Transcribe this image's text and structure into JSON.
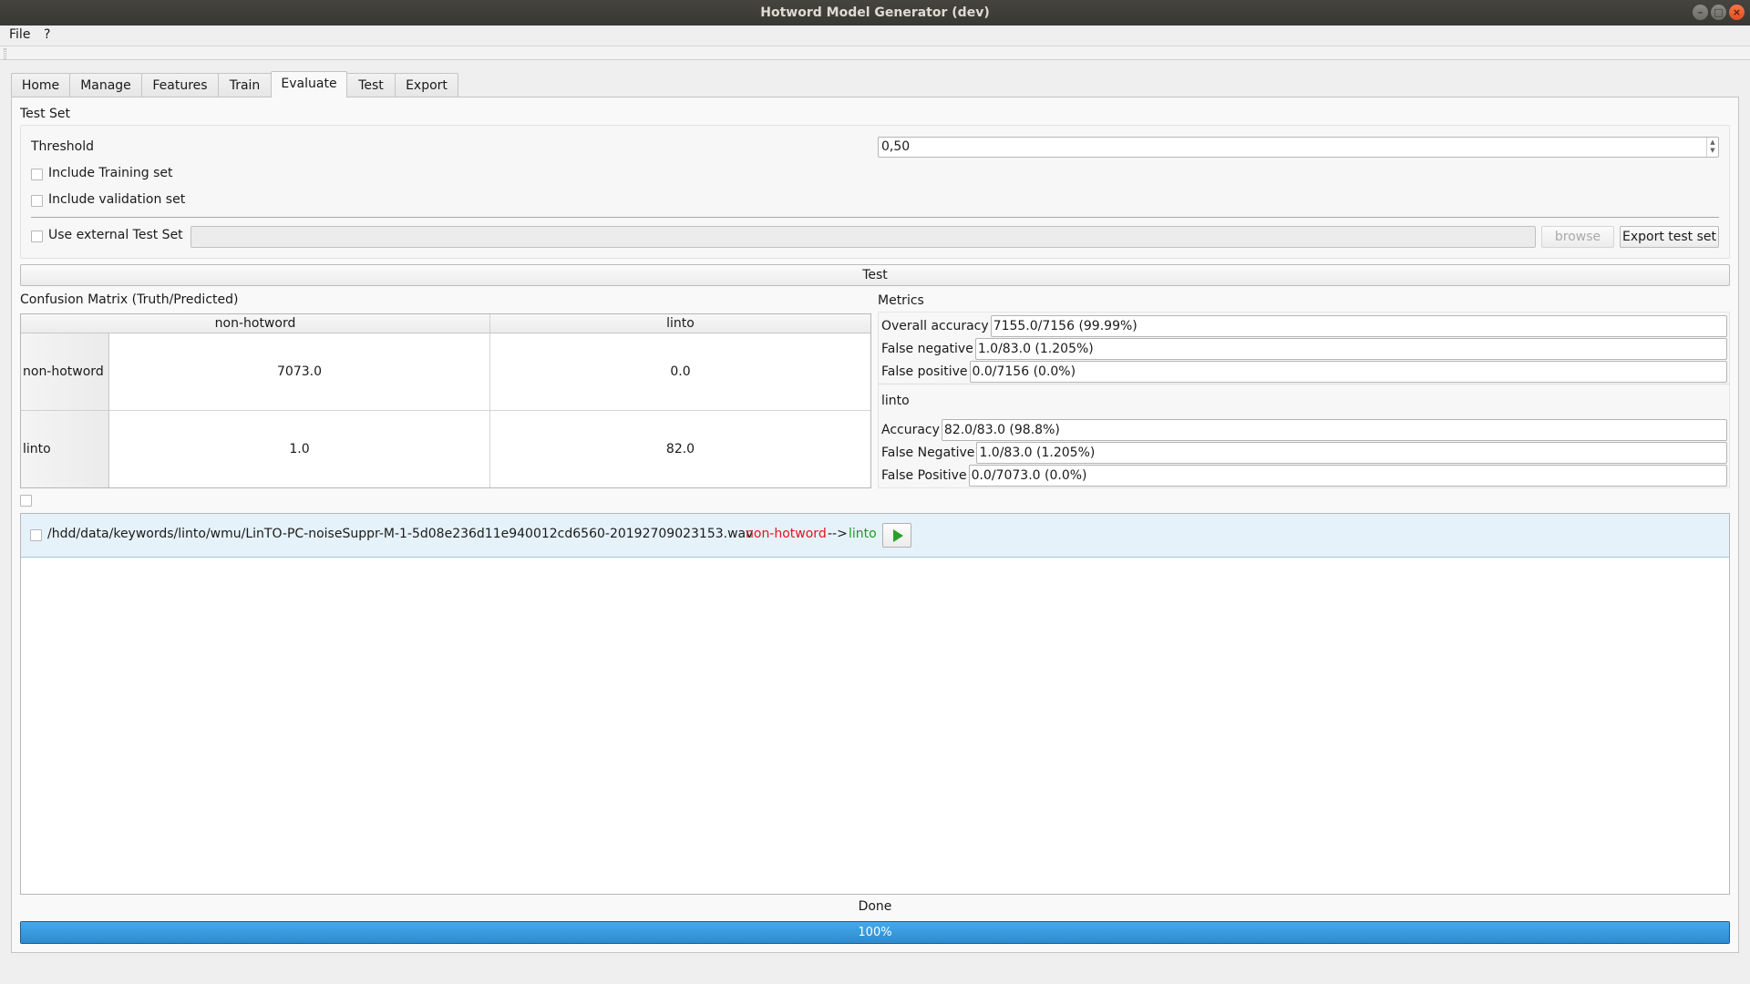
{
  "window": {
    "title": "Hotword Model Generator (dev)",
    "controls": {
      "minimize": "–",
      "maximize": "□",
      "close": "×"
    }
  },
  "menu": {
    "items": [
      "File",
      "?"
    ]
  },
  "tabs": [
    {
      "label": "Home",
      "active": false
    },
    {
      "label": "Manage",
      "active": false
    },
    {
      "label": "Features",
      "active": false
    },
    {
      "label": "Train",
      "active": false
    },
    {
      "label": "Evaluate",
      "active": true
    },
    {
      "label": "Test",
      "active": false
    },
    {
      "label": "Export",
      "active": false
    }
  ],
  "test_set": {
    "section_label": "Test Set",
    "threshold_label": "Threshold",
    "threshold_value": "0,50",
    "spin_up_icon": "▲",
    "spin_down_icon": "▼",
    "include_training": {
      "label": "Include Training set",
      "checked": false
    },
    "include_validation": {
      "label": "Include validation set",
      "checked": false
    },
    "external": {
      "label": "Use external Test Set",
      "checked": false,
      "path": ""
    },
    "browse_label": "browse",
    "export_label": "Export test set"
  },
  "test_button_label": "Test",
  "confusion_matrix": {
    "title": "Confusion Matrix (Truth/Predicted)",
    "columns": [
      "non-hotword",
      "linto"
    ],
    "rows": [
      {
        "label": "non-hotword",
        "values": [
          "7073.0",
          "0.0"
        ]
      },
      {
        "label": "linto",
        "values": [
          "1.0",
          "82.0"
        ]
      }
    ]
  },
  "metrics": {
    "title": "Metrics",
    "overall": [
      {
        "label": "Overall accuracy",
        "value": "7155.0/7156 (99.99%)"
      },
      {
        "label": "False negative",
        "value": "1.0/83.0 (1.205%)"
      },
      {
        "label": "False positive",
        "value": "0.0/7156 (0.0%)"
      }
    ],
    "class_name": "linto",
    "per_class": [
      {
        "label": "Accuracy",
        "value": "82.0/83.0 (98.8%)"
      },
      {
        "label": "False Negative",
        "value": "1.0/83.0 (1.205%)"
      },
      {
        "label": "False Positive",
        "value": "0.0/7073.0 (0.0%)"
      }
    ]
  },
  "results": {
    "select_all_checked": false,
    "items": [
      {
        "checked": false,
        "path": "/hdd/data/keywords/linto/wmu/LinTO-PC-noiseSuppr-M-1-5d08e236d11e940012cd6560-20192709023153.wav",
        "truth": "non-hotword",
        "arrow": "-->",
        "predicted": "linto",
        "truth_color": "#e0141e",
        "predicted_color": "#1e9a1e",
        "play_icon": "play-icon"
      }
    ]
  },
  "status": {
    "label": "Done",
    "progress_percent": 100,
    "progress_text": "100%"
  }
}
